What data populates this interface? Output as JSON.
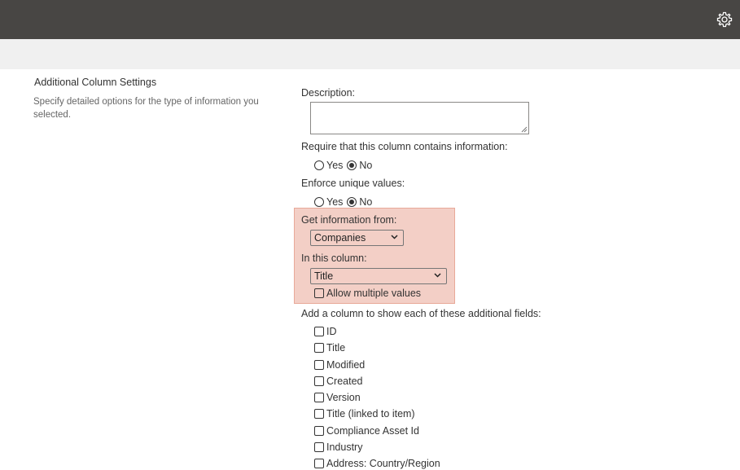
{
  "section": {
    "title": "Additional Column Settings",
    "description": "Specify detailed options for the type of information you selected."
  },
  "description_field": {
    "label": "Description:",
    "value": ""
  },
  "require": {
    "label": "Require that this column contains information:",
    "options": [
      "Yes",
      "No"
    ],
    "selected": "No"
  },
  "unique": {
    "label": "Enforce unique values:",
    "options": [
      "Yes",
      "No"
    ],
    "selected": "No"
  },
  "get_info": {
    "label": "Get information from:",
    "selected": "Companies"
  },
  "in_column": {
    "label": "In this column:",
    "selected": "Title"
  },
  "allow_multiple": {
    "label": "Allow multiple values",
    "checked": false
  },
  "additional_fields": {
    "label": "Add a column to show each of these additional fields:",
    "items": [
      "ID",
      "Title",
      "Modified",
      "Created",
      "Version",
      "Title (linked to item)",
      "Compliance Asset Id",
      "Industry",
      "Address: Country/Region"
    ]
  },
  "colors": {
    "topbar": "#484644",
    "subbar": "#f0f0f0",
    "highlight": "#f3cfc6"
  },
  "icons": {
    "settings": "gear-icon"
  }
}
